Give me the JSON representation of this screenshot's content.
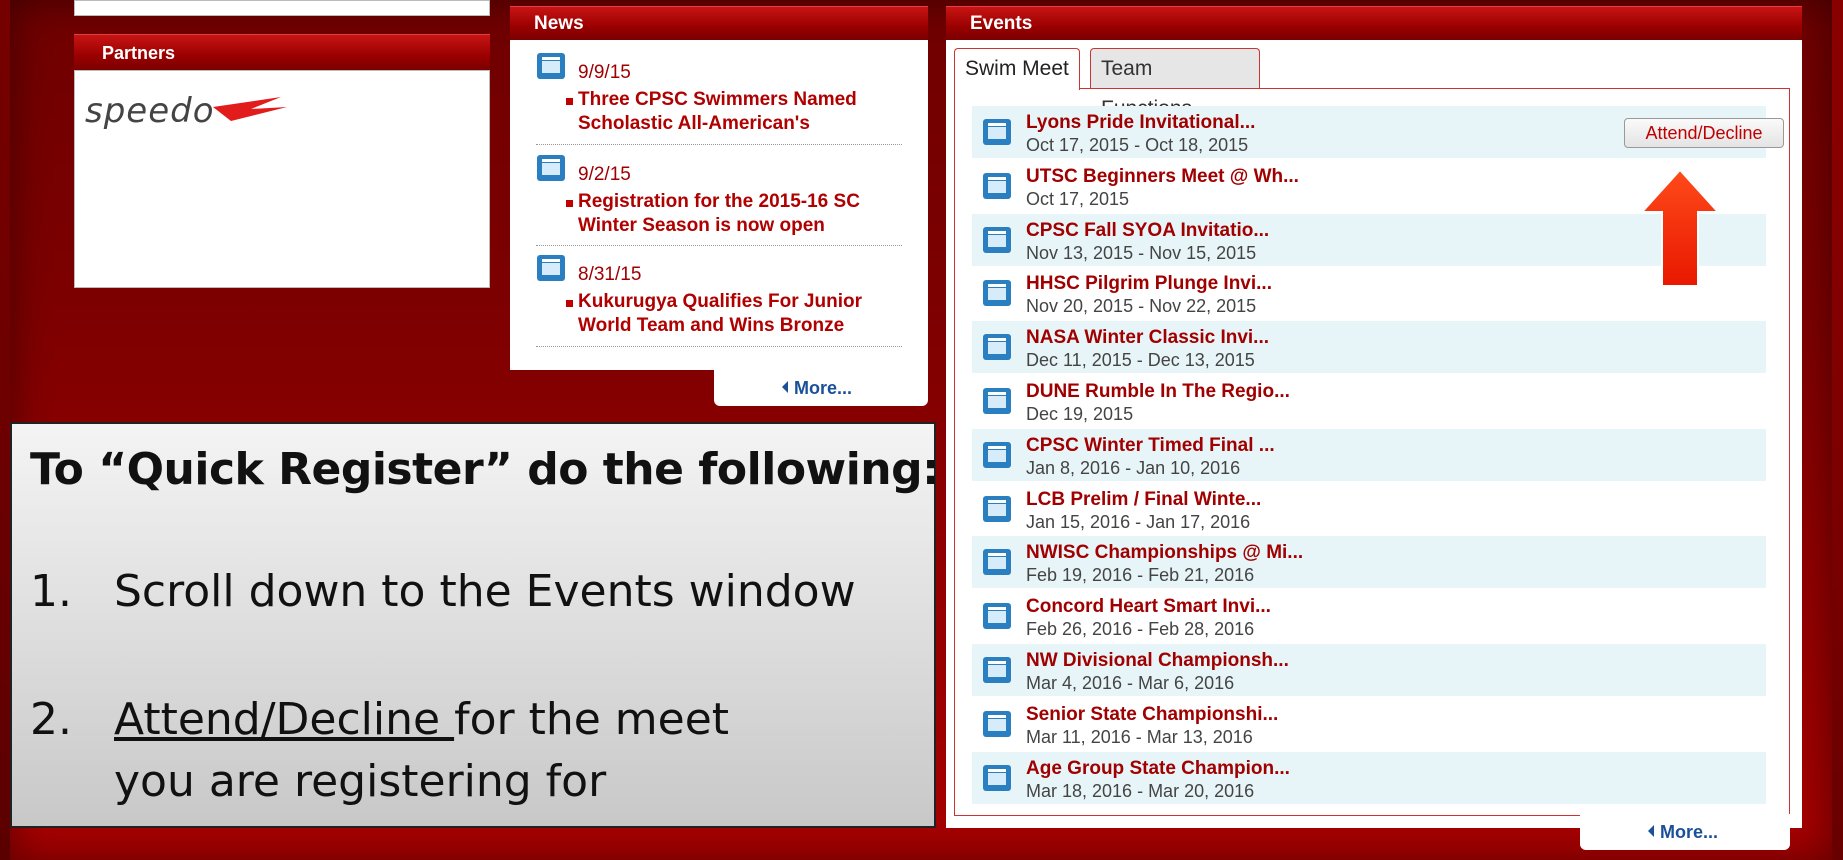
{
  "partners": {
    "title": "Partners",
    "logo_text": "speedo"
  },
  "news": {
    "title": "News",
    "items": [
      {
        "date": "9/9/15",
        "headline": "Three CPSC Swimmers Named Scholastic All-American's"
      },
      {
        "date": "9/2/15",
        "headline": "Registration for the 2015-16 SC Winter Season is now open"
      },
      {
        "date": "8/31/15",
        "headline": "Kukurugya Qualifies For Junior World Team and Wins Bronze"
      }
    ],
    "more_label": "More..."
  },
  "events": {
    "title": "Events",
    "tabs": [
      {
        "label": "Swim Meet",
        "active": true
      },
      {
        "label": "Team Functions",
        "active": false
      }
    ],
    "attend_label": "Attend/Decline",
    "rows": [
      {
        "title": "Lyons Pride Invitational...",
        "dates": "Oct 17, 2015 - Oct 18, 2015"
      },
      {
        "title": "UTSC Beginners Meet @ Wh...",
        "dates": "Oct 17, 2015"
      },
      {
        "title": "CPSC Fall SYOA Invitatio...",
        "dates": "Nov 13, 2015 - Nov 15, 2015"
      },
      {
        "title": "HHSC Pilgrim Plunge Invi...",
        "dates": "Nov 20, 2015 - Nov 22, 2015"
      },
      {
        "title": "NASA Winter Classic Invi...",
        "dates": "Dec 11, 2015 - Dec 13, 2015"
      },
      {
        "title": "DUNE Rumble In The Regio...",
        "dates": "Dec 19, 2015"
      },
      {
        "title": "CPSC Winter Timed Final ...",
        "dates": "Jan 8, 2016 - Jan 10, 2016"
      },
      {
        "title": "LCB Prelim / Final Winte...",
        "dates": "Jan 15, 2016 - Jan 17, 2016"
      },
      {
        "title": "NWISC Championships @ Mi...",
        "dates": "Feb 19, 2016 - Feb 21, 2016"
      },
      {
        "title": "Concord Heart Smart Invi...",
        "dates": "Feb 26, 2016 - Feb 28, 2016"
      },
      {
        "title": "NW Divisional Championsh...",
        "dates": "Mar 4, 2016 - Mar 6, 2016"
      },
      {
        "title": "Senior State Championshi...",
        "dates": "Mar 11, 2016 - Mar 13, 2016"
      },
      {
        "title": "Age Group State Champion...",
        "dates": "Mar 18, 2016 - Mar 20, 2016"
      }
    ],
    "more_label": "More..."
  },
  "instructions": {
    "heading": "To “Quick Register” do the following:",
    "step1_num": "1.",
    "step1_text": "Scroll down to the Events window",
    "step2_num": "2.",
    "step2_link": "Attend/Decline ",
    "step2_rest": "for the meet",
    "step2_line2": "you are registering for"
  },
  "colors": {
    "brand_red": "#a00000",
    "link_blue": "#1a4f9a",
    "arrow_red": "#ff2200"
  }
}
